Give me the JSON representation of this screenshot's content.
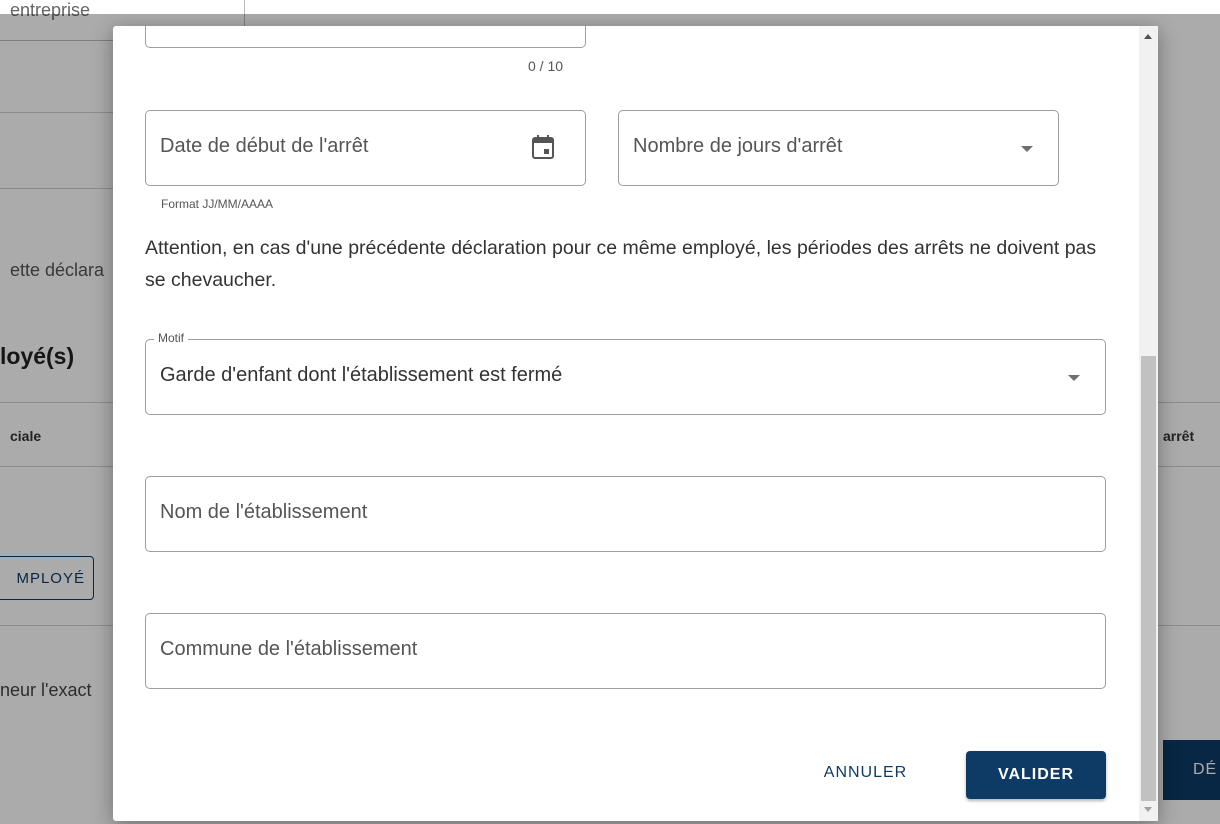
{
  "background": {
    "entreprise_fragment": "entreprise",
    "declaration_fragment": "ette déclara",
    "employes_heading_fragment": "loyé(s)",
    "column_sociale_fragment": "ciale",
    "column_arret_fragment": "arrêt",
    "add_employee_button_fragment": "MPLOYÉ",
    "honneur_fragment": "neur l'exact",
    "declare_button_fragment": "DÉ"
  },
  "modal": {
    "char_counter": "0 / 10",
    "date_field": {
      "placeholder": "Date de début de l'arrêt",
      "hint": "Format JJ/MM/AAAA",
      "icon": "calendar-icon"
    },
    "jours_field": {
      "placeholder": "Nombre de jours d'arrêt",
      "icon": "caret-down-icon"
    },
    "warning": "Attention, en cas d'une précédente déclaration pour ce même employé, les périodes des arrêts ne doivent pas se chevaucher.",
    "motif_field": {
      "label": "Motif",
      "value": "Garde d'enfant dont l'établissement est fermé",
      "icon": "caret-down-icon"
    },
    "nom_field": {
      "placeholder": "Nom de l'établissement"
    },
    "commune_field": {
      "placeholder": "Commune de l'établissement"
    },
    "buttons": {
      "cancel": "ANNULER",
      "submit": "VALIDER"
    }
  },
  "colors": {
    "primary": "#0d3b66",
    "border": "#9e9e9e",
    "text": "#333333",
    "overlay": "rgba(0,0,0,0.33)"
  }
}
